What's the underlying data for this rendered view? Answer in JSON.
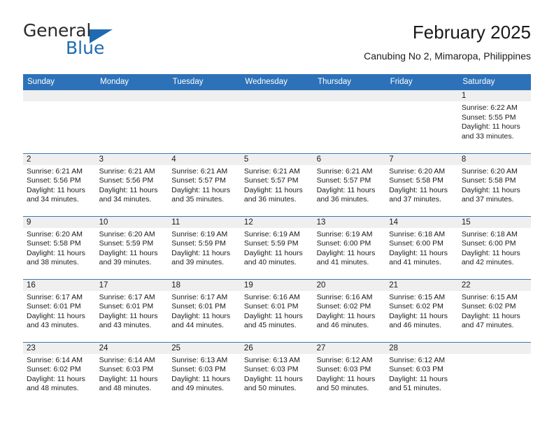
{
  "brand": {
    "name_top": "General",
    "name_bottom": "Blue",
    "accent_color": "#1f6bb0"
  },
  "header": {
    "title": "February 2025",
    "subtitle": "Canubing No 2, Mimaropa, Philippines"
  },
  "theme": {
    "header_row_bg": "#2d72b8",
    "daynum_bg": "#efefef",
    "week_divider": "#3c78b4",
    "text": "#1a1a1a"
  },
  "labels": {
    "sunrise_prefix": "Sunrise:",
    "sunset_prefix": "Sunset:",
    "daylight_prefix": "Daylight:"
  },
  "weekday_headers": [
    "Sunday",
    "Monday",
    "Tuesday",
    "Wednesday",
    "Thursday",
    "Friday",
    "Saturday"
  ],
  "weeks": [
    [
      {
        "blank": true
      },
      {
        "blank": true
      },
      {
        "blank": true
      },
      {
        "blank": true
      },
      {
        "blank": true
      },
      {
        "blank": true
      },
      {
        "day": "1",
        "sunrise": "Sunrise: 6:22 AM",
        "sunset": "Sunset: 5:55 PM",
        "daylight": "Daylight: 11 hours and 33 minutes."
      }
    ],
    [
      {
        "day": "2",
        "sunrise": "Sunrise: 6:21 AM",
        "sunset": "Sunset: 5:56 PM",
        "daylight": "Daylight: 11 hours and 34 minutes."
      },
      {
        "day": "3",
        "sunrise": "Sunrise: 6:21 AM",
        "sunset": "Sunset: 5:56 PM",
        "daylight": "Daylight: 11 hours and 34 minutes."
      },
      {
        "day": "4",
        "sunrise": "Sunrise: 6:21 AM",
        "sunset": "Sunset: 5:57 PM",
        "daylight": "Daylight: 11 hours and 35 minutes."
      },
      {
        "day": "5",
        "sunrise": "Sunrise: 6:21 AM",
        "sunset": "Sunset: 5:57 PM",
        "daylight": "Daylight: 11 hours and 36 minutes."
      },
      {
        "day": "6",
        "sunrise": "Sunrise: 6:21 AM",
        "sunset": "Sunset: 5:57 PM",
        "daylight": "Daylight: 11 hours and 36 minutes."
      },
      {
        "day": "7",
        "sunrise": "Sunrise: 6:20 AM",
        "sunset": "Sunset: 5:58 PM",
        "daylight": "Daylight: 11 hours and 37 minutes."
      },
      {
        "day": "8",
        "sunrise": "Sunrise: 6:20 AM",
        "sunset": "Sunset: 5:58 PM",
        "daylight": "Daylight: 11 hours and 37 minutes."
      }
    ],
    [
      {
        "day": "9",
        "sunrise": "Sunrise: 6:20 AM",
        "sunset": "Sunset: 5:58 PM",
        "daylight": "Daylight: 11 hours and 38 minutes."
      },
      {
        "day": "10",
        "sunrise": "Sunrise: 6:20 AM",
        "sunset": "Sunset: 5:59 PM",
        "daylight": "Daylight: 11 hours and 39 minutes."
      },
      {
        "day": "11",
        "sunrise": "Sunrise: 6:19 AM",
        "sunset": "Sunset: 5:59 PM",
        "daylight": "Daylight: 11 hours and 39 minutes."
      },
      {
        "day": "12",
        "sunrise": "Sunrise: 6:19 AM",
        "sunset": "Sunset: 5:59 PM",
        "daylight": "Daylight: 11 hours and 40 minutes."
      },
      {
        "day": "13",
        "sunrise": "Sunrise: 6:19 AM",
        "sunset": "Sunset: 6:00 PM",
        "daylight": "Daylight: 11 hours and 41 minutes."
      },
      {
        "day": "14",
        "sunrise": "Sunrise: 6:18 AM",
        "sunset": "Sunset: 6:00 PM",
        "daylight": "Daylight: 11 hours and 41 minutes."
      },
      {
        "day": "15",
        "sunrise": "Sunrise: 6:18 AM",
        "sunset": "Sunset: 6:00 PM",
        "daylight": "Daylight: 11 hours and 42 minutes."
      }
    ],
    [
      {
        "day": "16",
        "sunrise": "Sunrise: 6:17 AM",
        "sunset": "Sunset: 6:01 PM",
        "daylight": "Daylight: 11 hours and 43 minutes."
      },
      {
        "day": "17",
        "sunrise": "Sunrise: 6:17 AM",
        "sunset": "Sunset: 6:01 PM",
        "daylight": "Daylight: 11 hours and 43 minutes."
      },
      {
        "day": "18",
        "sunrise": "Sunrise: 6:17 AM",
        "sunset": "Sunset: 6:01 PM",
        "daylight": "Daylight: 11 hours and 44 minutes."
      },
      {
        "day": "19",
        "sunrise": "Sunrise: 6:16 AM",
        "sunset": "Sunset: 6:01 PM",
        "daylight": "Daylight: 11 hours and 45 minutes."
      },
      {
        "day": "20",
        "sunrise": "Sunrise: 6:16 AM",
        "sunset": "Sunset: 6:02 PM",
        "daylight": "Daylight: 11 hours and 46 minutes."
      },
      {
        "day": "21",
        "sunrise": "Sunrise: 6:15 AM",
        "sunset": "Sunset: 6:02 PM",
        "daylight": "Daylight: 11 hours and 46 minutes."
      },
      {
        "day": "22",
        "sunrise": "Sunrise: 6:15 AM",
        "sunset": "Sunset: 6:02 PM",
        "daylight": "Daylight: 11 hours and 47 minutes."
      }
    ],
    [
      {
        "day": "23",
        "sunrise": "Sunrise: 6:14 AM",
        "sunset": "Sunset: 6:02 PM",
        "daylight": "Daylight: 11 hours and 48 minutes."
      },
      {
        "day": "24",
        "sunrise": "Sunrise: 6:14 AM",
        "sunset": "Sunset: 6:03 PM",
        "daylight": "Daylight: 11 hours and 48 minutes."
      },
      {
        "day": "25",
        "sunrise": "Sunrise: 6:13 AM",
        "sunset": "Sunset: 6:03 PM",
        "daylight": "Daylight: 11 hours and 49 minutes."
      },
      {
        "day": "26",
        "sunrise": "Sunrise: 6:13 AM",
        "sunset": "Sunset: 6:03 PM",
        "daylight": "Daylight: 11 hours and 50 minutes."
      },
      {
        "day": "27",
        "sunrise": "Sunrise: 6:12 AM",
        "sunset": "Sunset: 6:03 PM",
        "daylight": "Daylight: 11 hours and 50 minutes."
      },
      {
        "day": "28",
        "sunrise": "Sunrise: 6:12 AM",
        "sunset": "Sunset: 6:03 PM",
        "daylight": "Daylight: 11 hours and 51 minutes."
      },
      {
        "blank": true
      }
    ]
  ]
}
